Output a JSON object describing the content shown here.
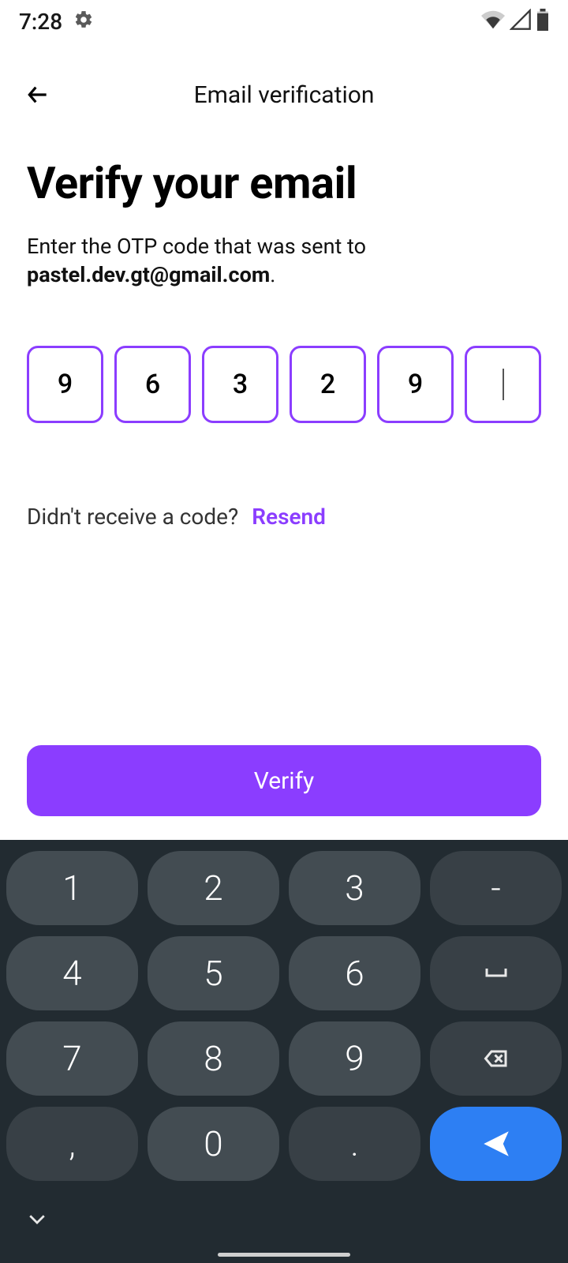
{
  "status": {
    "time": "7:28"
  },
  "header": {
    "title": "Email verification"
  },
  "main": {
    "heading": "Verify your email",
    "subtext_prefix": "Enter the OTP code that was sent to ",
    "email": "pastel.dev.gt@gmail.com",
    "subtext_suffix": "."
  },
  "otp": {
    "digits": [
      "9",
      "6",
      "3",
      "2",
      "9",
      ""
    ]
  },
  "resend": {
    "question": "Didn't receive a code?",
    "link": "Resend"
  },
  "verify": {
    "label": "Verify"
  },
  "keyboard": {
    "rows": [
      [
        "1",
        "2",
        "3",
        "-"
      ],
      [
        "4",
        "5",
        "6",
        "␣"
      ],
      [
        "7",
        "8",
        "9",
        "⌫"
      ],
      [
        ",",
        "0",
        ".",
        "➤"
      ]
    ]
  },
  "colors": {
    "accent": "#8B3DFF",
    "keyboard_bg": "#222b31",
    "key_bg": "#434c52",
    "send_bg": "#2d7ff3"
  }
}
